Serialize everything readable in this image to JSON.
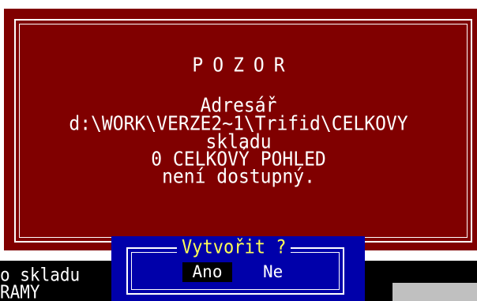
{
  "warning": {
    "title": "POZOR",
    "lines": [
      "Adresář",
      "d:\\WORK\\VERZE2~1\\Trifid\\CELKOVY",
      "skladu",
      "0 CELKOVÝ POHLED",
      "není dostupný."
    ]
  },
  "confirm": {
    "title": "Vytvořit ?",
    "yes_label": "Ano",
    "no_label": "Ne"
  },
  "status": {
    "line1": "o skladu",
    "line2": "RAMY"
  },
  "colors": {
    "warning_bg": "#800000",
    "dialog_bg": "#0000aa",
    "dialog_title": "#ffff55",
    "text": "#ffffff",
    "selected_button_bg": "#000000"
  }
}
